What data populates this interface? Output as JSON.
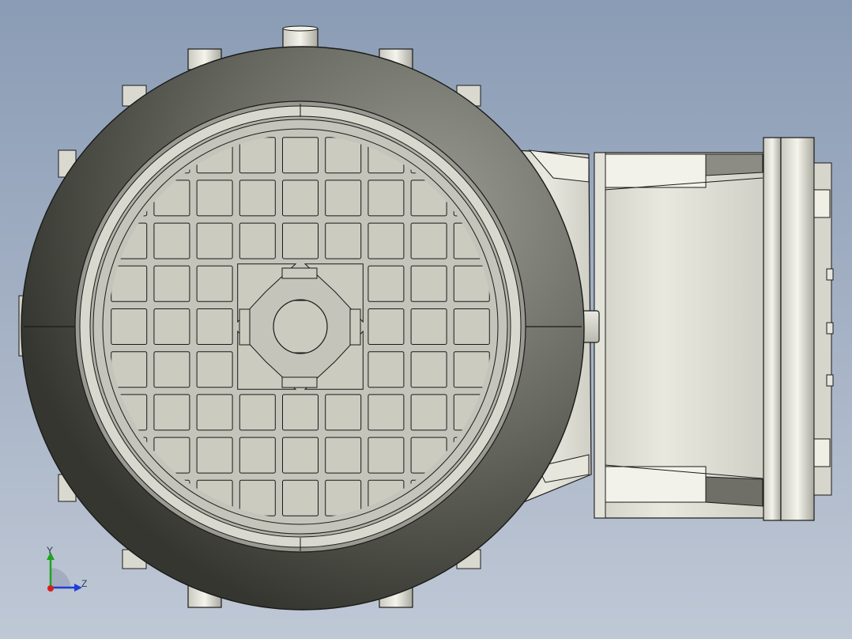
{
  "model_view": {
    "colors": {
      "background_top": "#8a9cb5",
      "background_bottom": "#bfc8d5",
      "housing_dark": "#3f403a",
      "housing_light": "#8d8e86",
      "face_plate": "#bdbdb2",
      "grille_cell": "#cbcbc0",
      "gearbox_body": "#dcdcd2",
      "edge_line": "#1a1a1a"
    },
    "triad": {
      "y_label": "Y",
      "z_label": "Z",
      "y_axis_color": "#1fa31f",
      "z_axis_color": "#1f3fd6",
      "x_axis_color": "#d41f1f"
    }
  }
}
